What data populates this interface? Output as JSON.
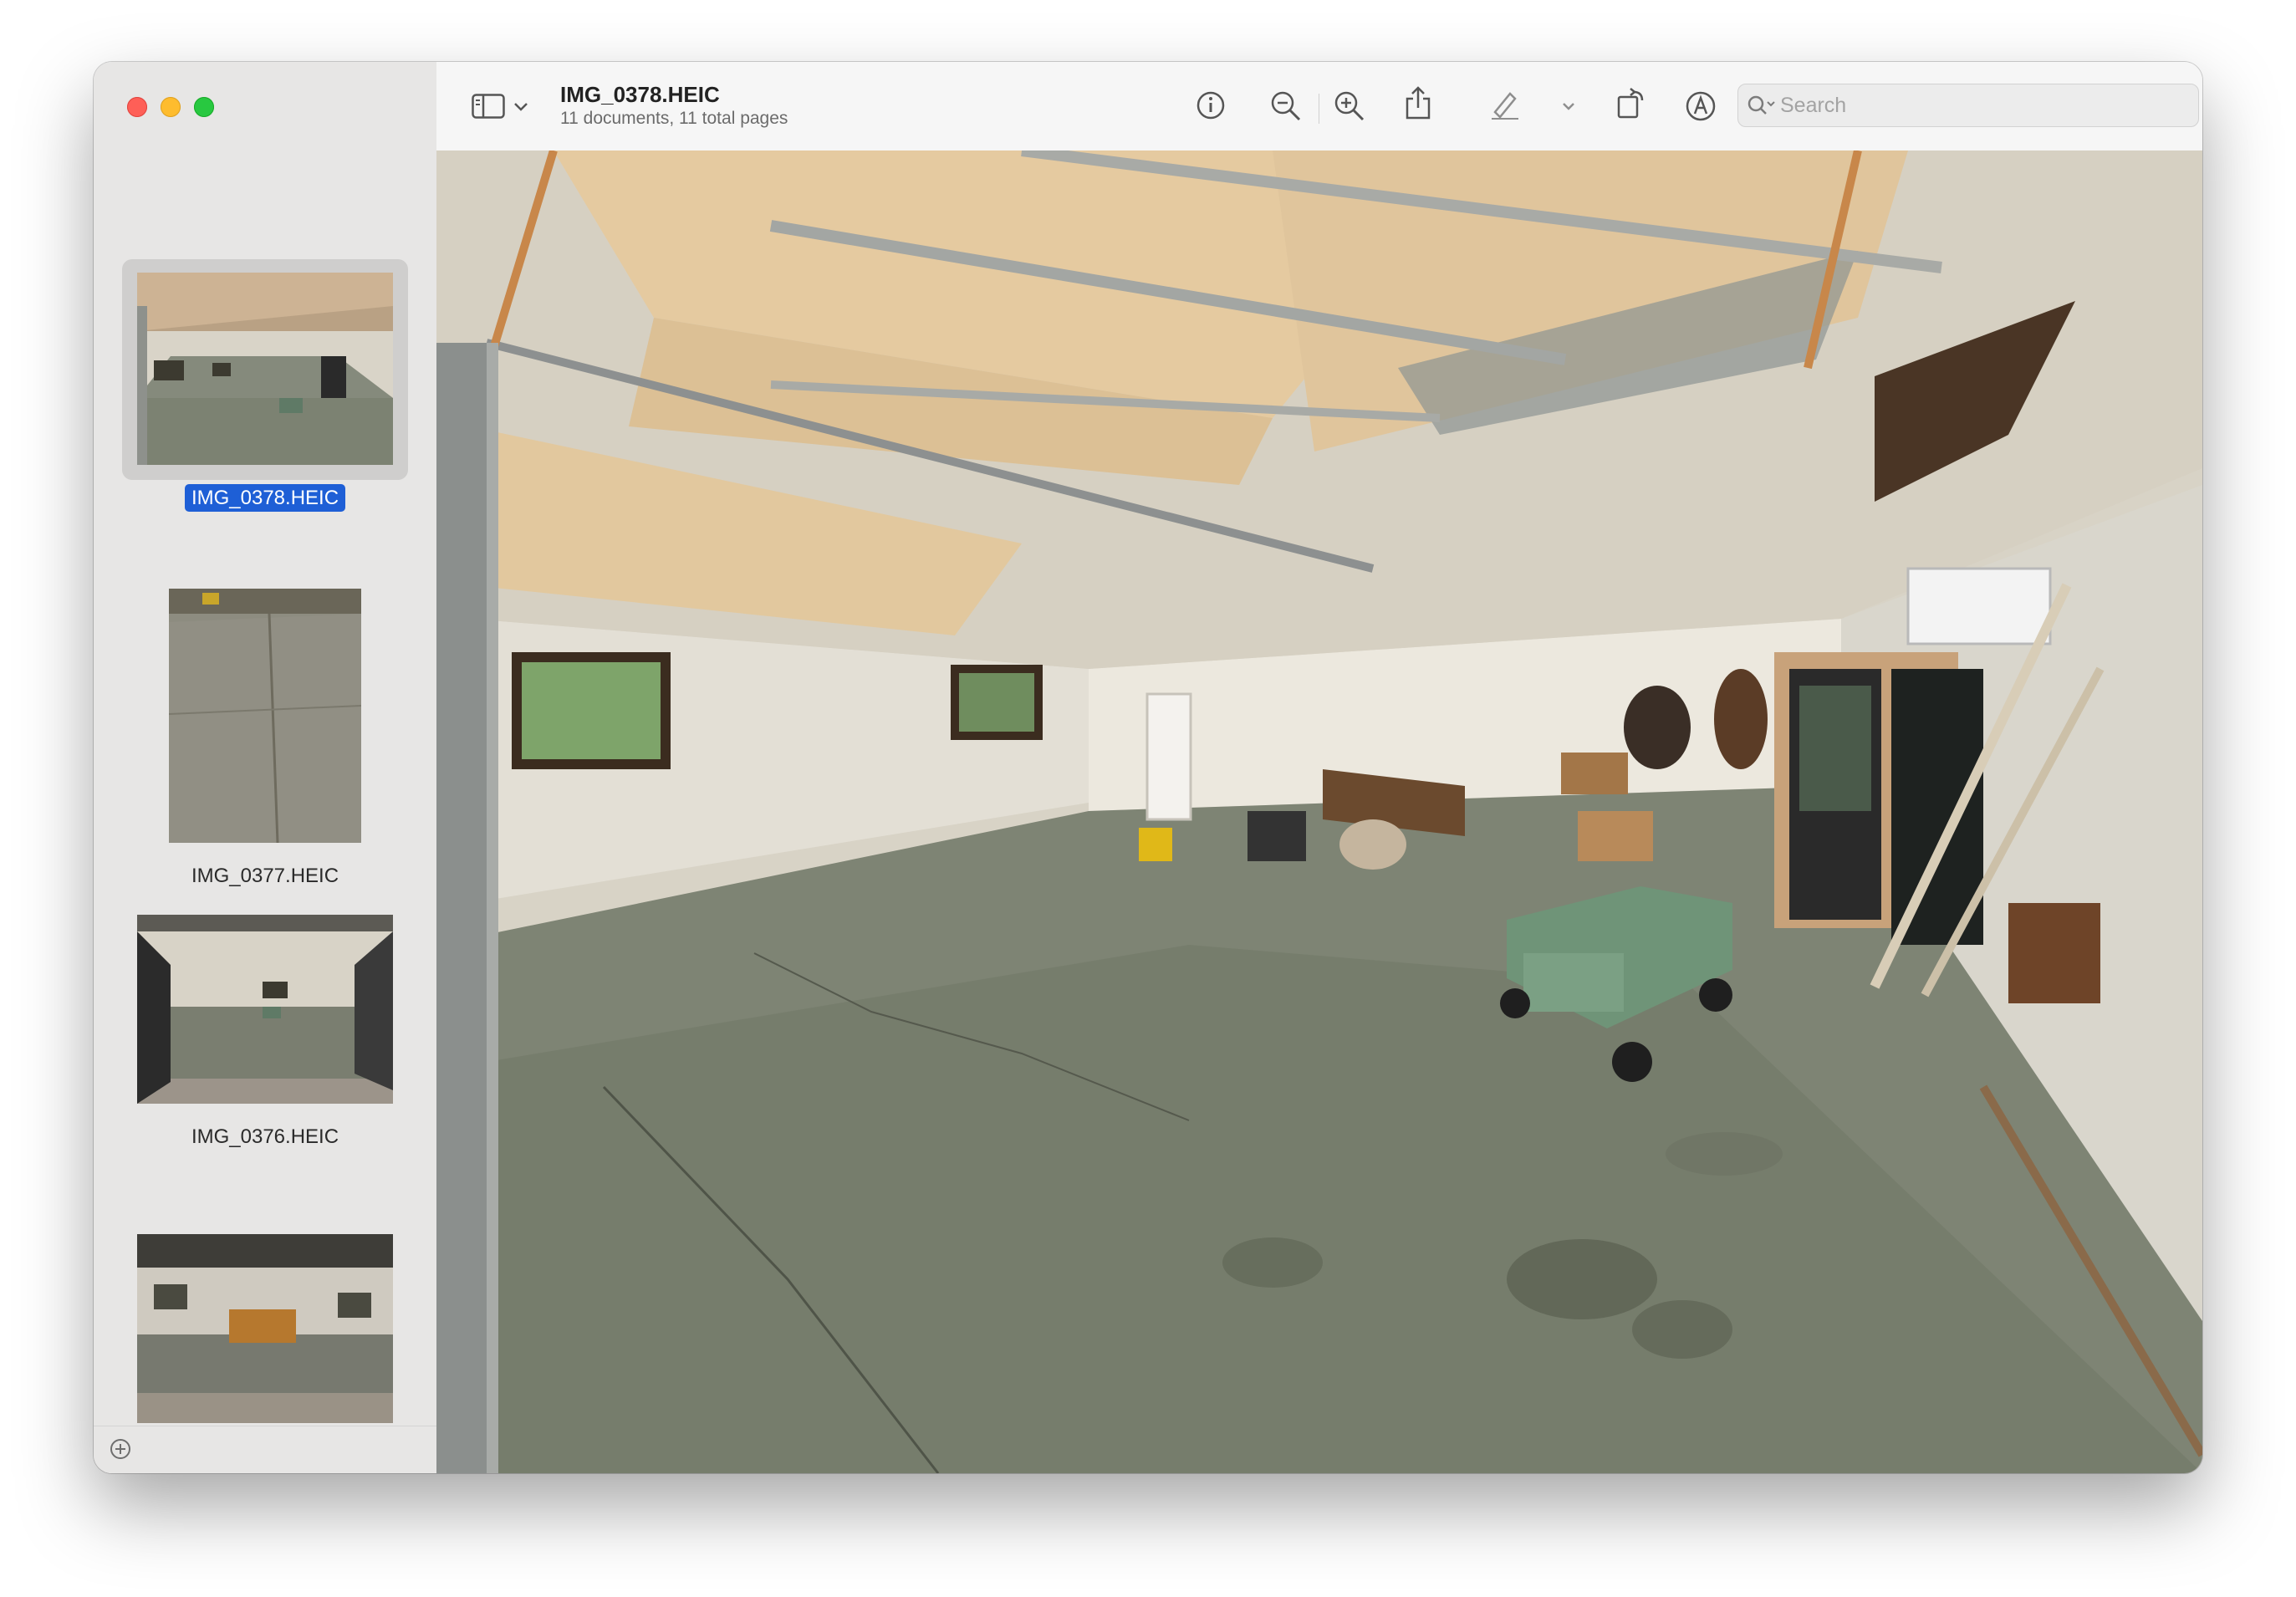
{
  "window": {
    "controls": {
      "close": "close",
      "minimize": "minimize",
      "zoom": "zoom"
    }
  },
  "toolbar": {
    "document_title": "IMG_0378.HEIC",
    "document_subtitle": "11 documents, 11 total pages",
    "icons": [
      "sidebar-toggle-icon",
      "chevron-down-icon",
      "info-icon",
      "zoom-out-icon",
      "zoom-in-icon",
      "share-icon",
      "markup-pen-icon",
      "chevron-down-icon",
      "rotate-icon",
      "annotate-icon",
      "redact-icon"
    ],
    "search": {
      "placeholder": "Search",
      "value": ""
    }
  },
  "sidebar": {
    "thumbnails": [
      {
        "label": "IMG_0378.HEIC",
        "selected": true
      },
      {
        "label": "IMG_0377.HEIC",
        "selected": false
      },
      {
        "label": "IMG_0376.HEIC",
        "selected": false
      },
      {
        "label": "",
        "selected": false
      }
    ],
    "add_button": "add-icon"
  },
  "colors": {
    "selection_blue": "#1e5fd6",
    "close": "#fe5f57",
    "minimize": "#febc2e",
    "zoom": "#28c840"
  }
}
